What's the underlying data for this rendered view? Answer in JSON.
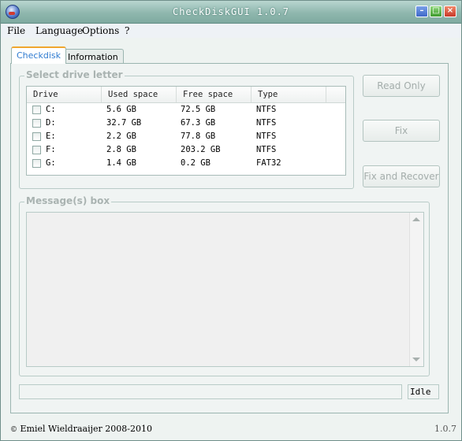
{
  "window": {
    "title": "CheckDiskGUI 1.0.7"
  },
  "menu": {
    "file": "File",
    "language": "Language",
    "options": "Options",
    "help": "?"
  },
  "tabs": {
    "checkdisk": "Checkdisk",
    "information": "Information"
  },
  "drive_group": {
    "legend": "Select drive letter",
    "columns": [
      "Drive",
      "Used space",
      "Free space",
      "Type"
    ],
    "rows": [
      [
        "C:",
        "5.6 GB",
        "72.5 GB",
        "NTFS"
      ],
      [
        "D:",
        "32.7 GB",
        "67.3 GB",
        "NTFS"
      ],
      [
        "E:",
        "2.2 GB",
        "77.8 GB",
        "NTFS"
      ],
      [
        "F:",
        "2.8 GB",
        "203.2 GB",
        "NTFS"
      ],
      [
        "G:",
        "1.4 GB",
        "0.2 GB",
        "FAT32"
      ]
    ]
  },
  "buttons": {
    "read_only": "Read Only",
    "fix": "Fix",
    "fix_recover": "Fix and Recover"
  },
  "message_group": {
    "legend": "Message(s) box"
  },
  "status": {
    "text": "Idle"
  },
  "footer": {
    "copyright": "Emiel Wieldraaijer 2008-2010",
    "version": "1.0.7"
  }
}
